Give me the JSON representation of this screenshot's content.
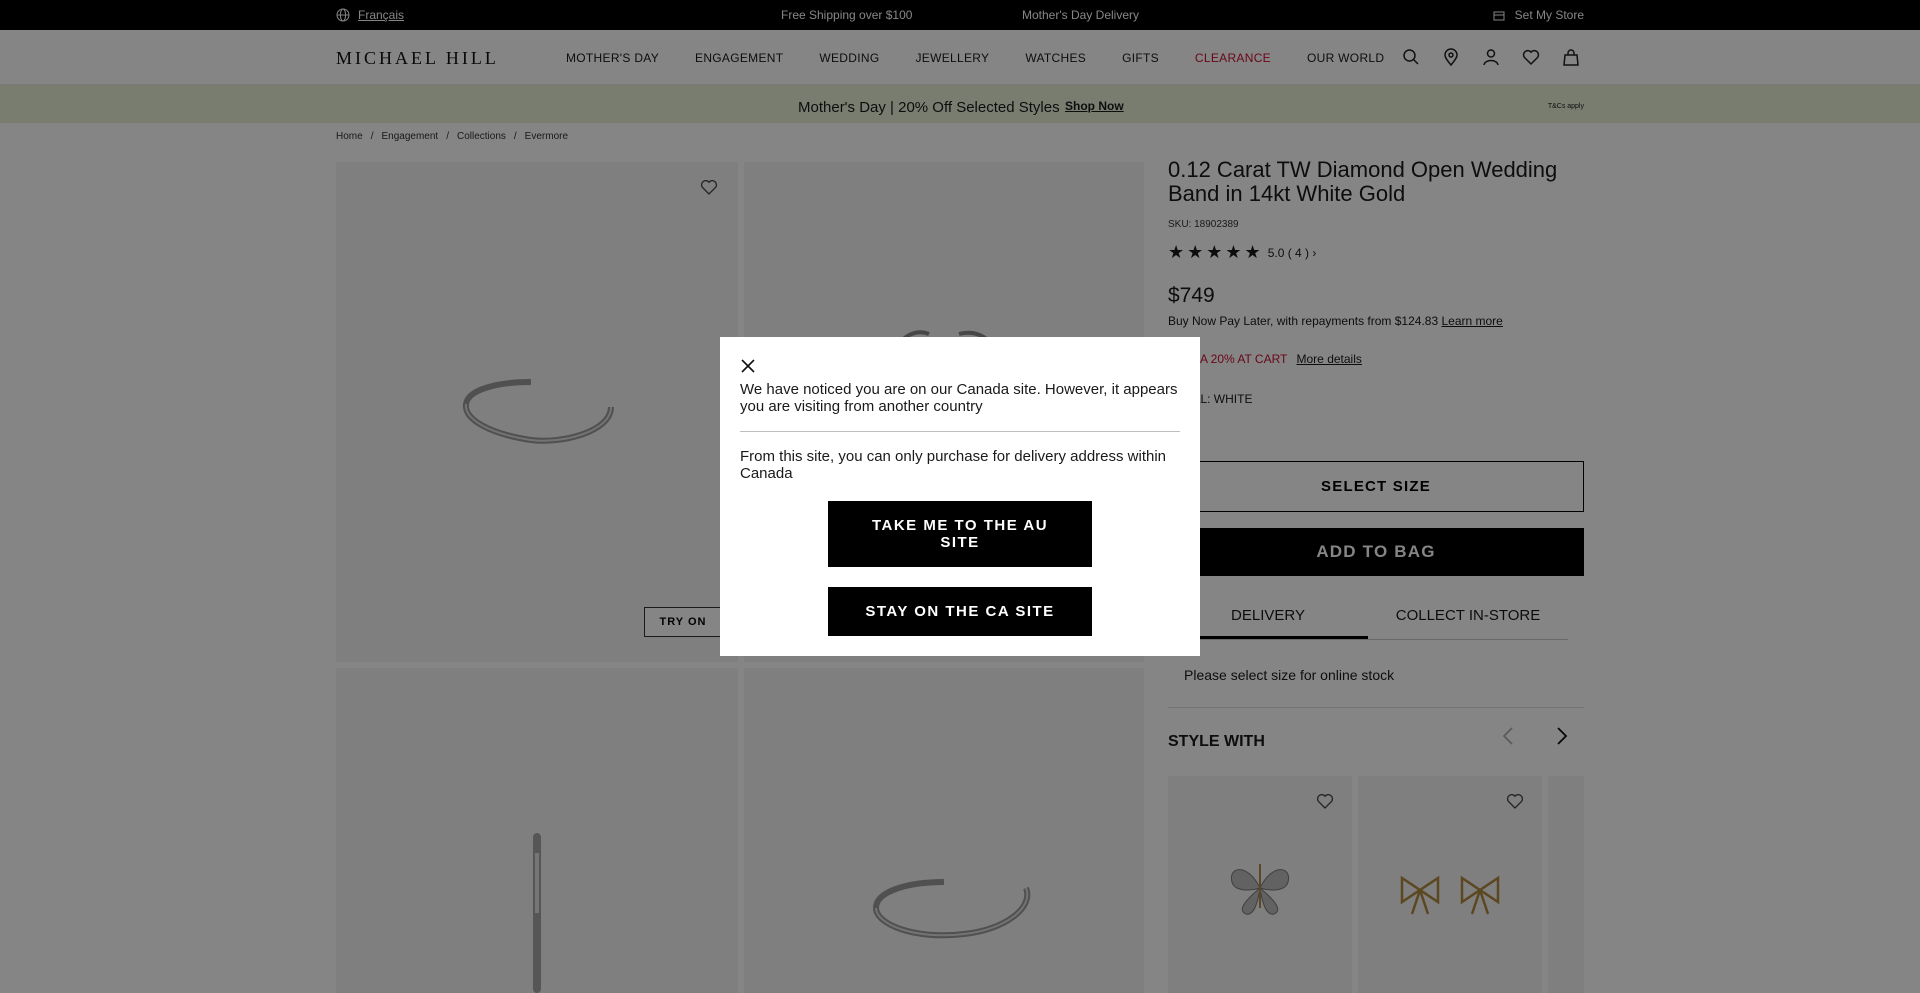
{
  "topbar": {
    "language_link": "Français",
    "promo_shipping": "Free Shipping over $100",
    "promo_delivery": "Mother's Day Delivery",
    "store_link": "Set My Store"
  },
  "header": {
    "logo": "MICHAEL HILL",
    "nav": [
      "MOTHER'S DAY",
      "ENGAGEMENT",
      "WEDDING",
      "JEWELLERY",
      "WATCHES",
      "GIFTS",
      "CLEARANCE",
      "OUR WORLD"
    ],
    "icons": [
      "search-icon",
      "store-locator-icon",
      "account-icon",
      "wishlist-icon",
      "bag-icon"
    ]
  },
  "banner": {
    "text": "Mother's Day | 20% Off Selected Styles",
    "link": "Shop Now",
    "terms": "T&Cs apply"
  },
  "breadcrumb": [
    "Home",
    "Engagement",
    "Collections",
    "Evermore"
  ],
  "gallery": {
    "try_on": "TRY ON"
  },
  "product": {
    "title": "0.12 Carat TW Diamond Open Wedding Band in 14kt White Gold",
    "sku": "SKU: 18902389",
    "rating_stars": "★★★★★",
    "rating_text": "5.0 ( 4 ) ›",
    "price": "$749",
    "bnpl_text": "Buy Now Pay Later, with repayments from $124.83",
    "bnpl_link": "Learn more",
    "promo_text": "EXTRA 20% AT CART",
    "promo_link": "More details",
    "metal_text": "METAL: WHITE",
    "select_size": "SELECT SIZE",
    "add_to_bag": "ADD TO BAG",
    "tab_delivery": "DELIVERY",
    "tab_collect": "COLLECT IN-STORE",
    "stock_message": "Please select size for online stock",
    "style_with": "STYLE WITH"
  },
  "modal": {
    "message1": "We have noticed you are on our Canada site. However, it appears you are visiting from another country",
    "message2": "From this site, you can only purchase for delivery address within Canada",
    "btn_au": "TAKE ME TO THE AU SITE",
    "btn_ca": "STAY ON THE CA SITE"
  },
  "colors": {
    "topbar_bg": "#000000",
    "banner_bg": "#e7f0d6",
    "clearance": "#c8102e",
    "overlay": "rgba(0,0,0,0.48)"
  }
}
